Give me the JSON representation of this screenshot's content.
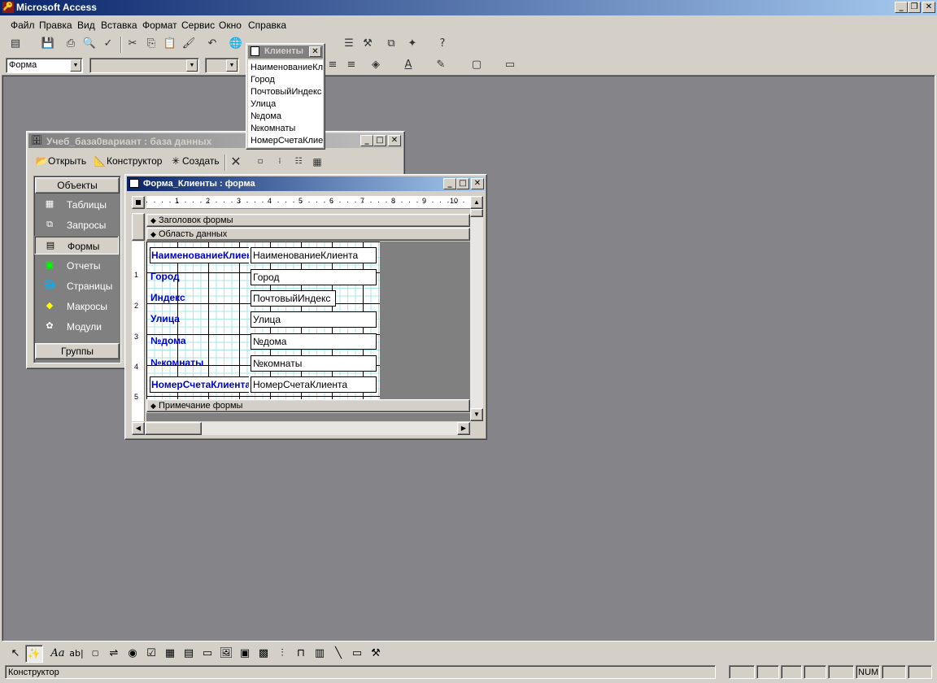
{
  "app": {
    "title": "Microsoft Access"
  },
  "menu": [
    "Файл",
    "Правка",
    "Вид",
    "Вставка",
    "Формат",
    "Сервис",
    "Окно",
    "Справка"
  ],
  "format_bar": {
    "object_combo": "Форма"
  },
  "field_list": {
    "title": "Клиенты",
    "items": [
      "НаименованиеКл",
      "Город",
      "ПочтовыйИндекс",
      "Улица",
      "№дома",
      "№комнаты",
      "НомерСчетаКлие"
    ]
  },
  "db_window": {
    "title": "Учеб_база0вариант : база данных",
    "toolbar": {
      "open": "Открыть",
      "design": "Конструктор",
      "create": "Создать"
    },
    "objects_header": "Объекты",
    "objects": [
      "Таблицы",
      "Запросы",
      "Формы",
      "Отчеты",
      "Страницы",
      "Макросы",
      "Модули"
    ],
    "groups": "Группы"
  },
  "form_window": {
    "title": "Форма_Клиенты : форма",
    "sections": {
      "header": "Заголовок формы",
      "detail": "Область данных",
      "footer": "Примечание формы"
    },
    "ruler_marks": [
      "1",
      "2",
      "3",
      "4",
      "5",
      "6",
      "7",
      "8",
      "9",
      "10"
    ],
    "vruler_marks": [
      "1",
      "2",
      "3",
      "4",
      "5"
    ],
    "fields": [
      {
        "label": "НаименованиеКлиен",
        "box": "НаименованиеКлиента"
      },
      {
        "label": "Город",
        "box": "Город"
      },
      {
        "label": "Индекс",
        "box": "ПочтовыйИндекс"
      },
      {
        "label": "Улица",
        "box": "Улица"
      },
      {
        "label": "№дома",
        "box": "№дома"
      },
      {
        "label": "№комнаты",
        "box": "№комнаты"
      },
      {
        "label": "НомерСчетаКлиента",
        "box": "НомерСчетаКлиента"
      }
    ]
  },
  "statusbar": {
    "mode": "Конструктор",
    "num": "NUM"
  },
  "colors": {
    "title_active": "#0a246a",
    "title_inactive": "#808080",
    "mdi_bg": "#858488",
    "label_text": "#0000cc"
  }
}
